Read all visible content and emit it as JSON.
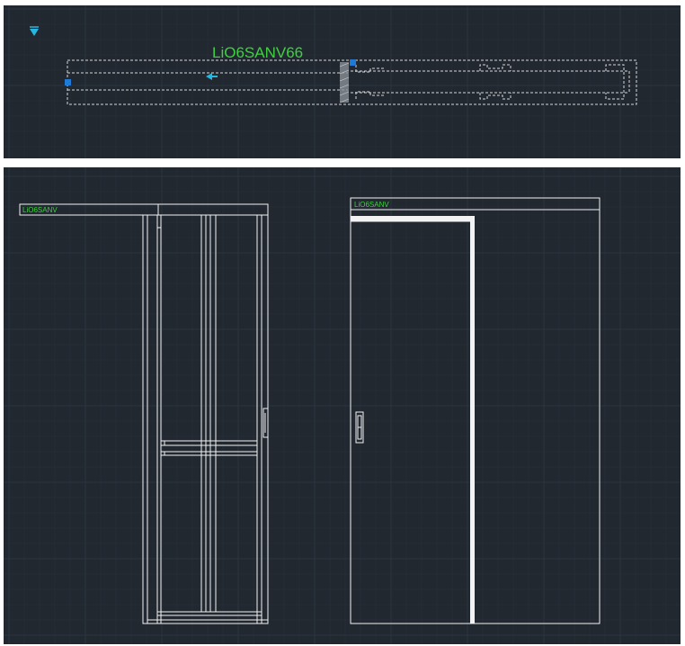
{
  "top_view": {
    "label": "LiO6SANV66"
  },
  "elevation_left": {
    "label": "LiO6SANV"
  },
  "elevation_right": {
    "label": "LiO6SANV"
  },
  "colors": {
    "background": "#212830",
    "grid_major": "#2c3440",
    "grid_minor": "#262d37",
    "lines": "#f2f2f2",
    "label_text": "#3fd13f",
    "grip_blue": "#1e7ad6",
    "cursor_cyan": "#26b6e0"
  }
}
